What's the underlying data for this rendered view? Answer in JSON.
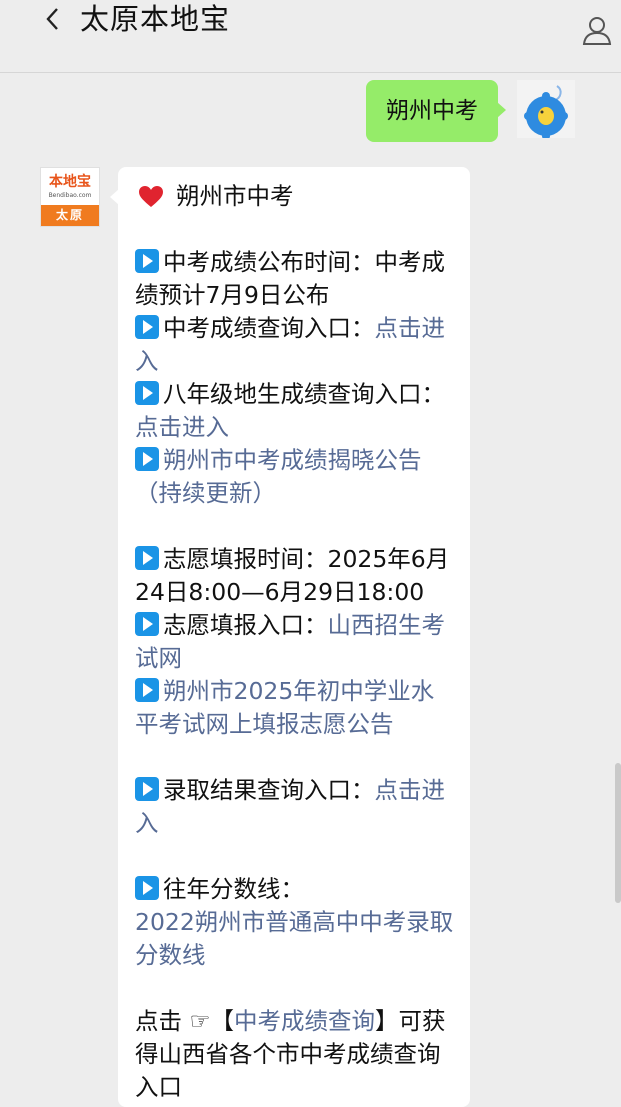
{
  "header": {
    "title": "太原本地宝"
  },
  "outgoing": {
    "text": "朔州中考"
  },
  "bot_avatar": {
    "brand": "本地宝",
    "url": "Bendibao.com",
    "city": "太原"
  },
  "message": {
    "heading": "朔州市中考",
    "items": [
      {
        "label": "中考成绩公布时间：",
        "text": "中考成绩预计7月9日公布"
      },
      {
        "label": "中考成绩查询入口：",
        "link": "点击进入"
      },
      {
        "label": "八年级地生成绩查询入口：",
        "link": "点击进入"
      },
      {
        "link": "朔州市中考成绩揭晓公告（持续更新）"
      },
      {
        "label": "志愿填报时间：",
        "text": "2025年6月24日8:00—6月29日18:00"
      },
      {
        "label": "志愿填报入口：",
        "link": "山西招生考试网"
      },
      {
        "link": "朔州市2025年初中学业水平考试网上填报志愿公告"
      },
      {
        "label": "录取结果查询入口：",
        "link": "点击进入"
      },
      {
        "label": "往年分数线：",
        "link": "2022朔州市普通高中中考录取分数线"
      }
    ],
    "footer": {
      "prefix": "点击 ☞【",
      "link": "中考成绩查询",
      "suffix": "】可获得山西省各个市中考成绩查询入口"
    }
  },
  "colors": {
    "bubble_out": "#95ec69",
    "link": "#576b95",
    "play_icon": "#1a94e6",
    "brand": "#f07b1f"
  }
}
